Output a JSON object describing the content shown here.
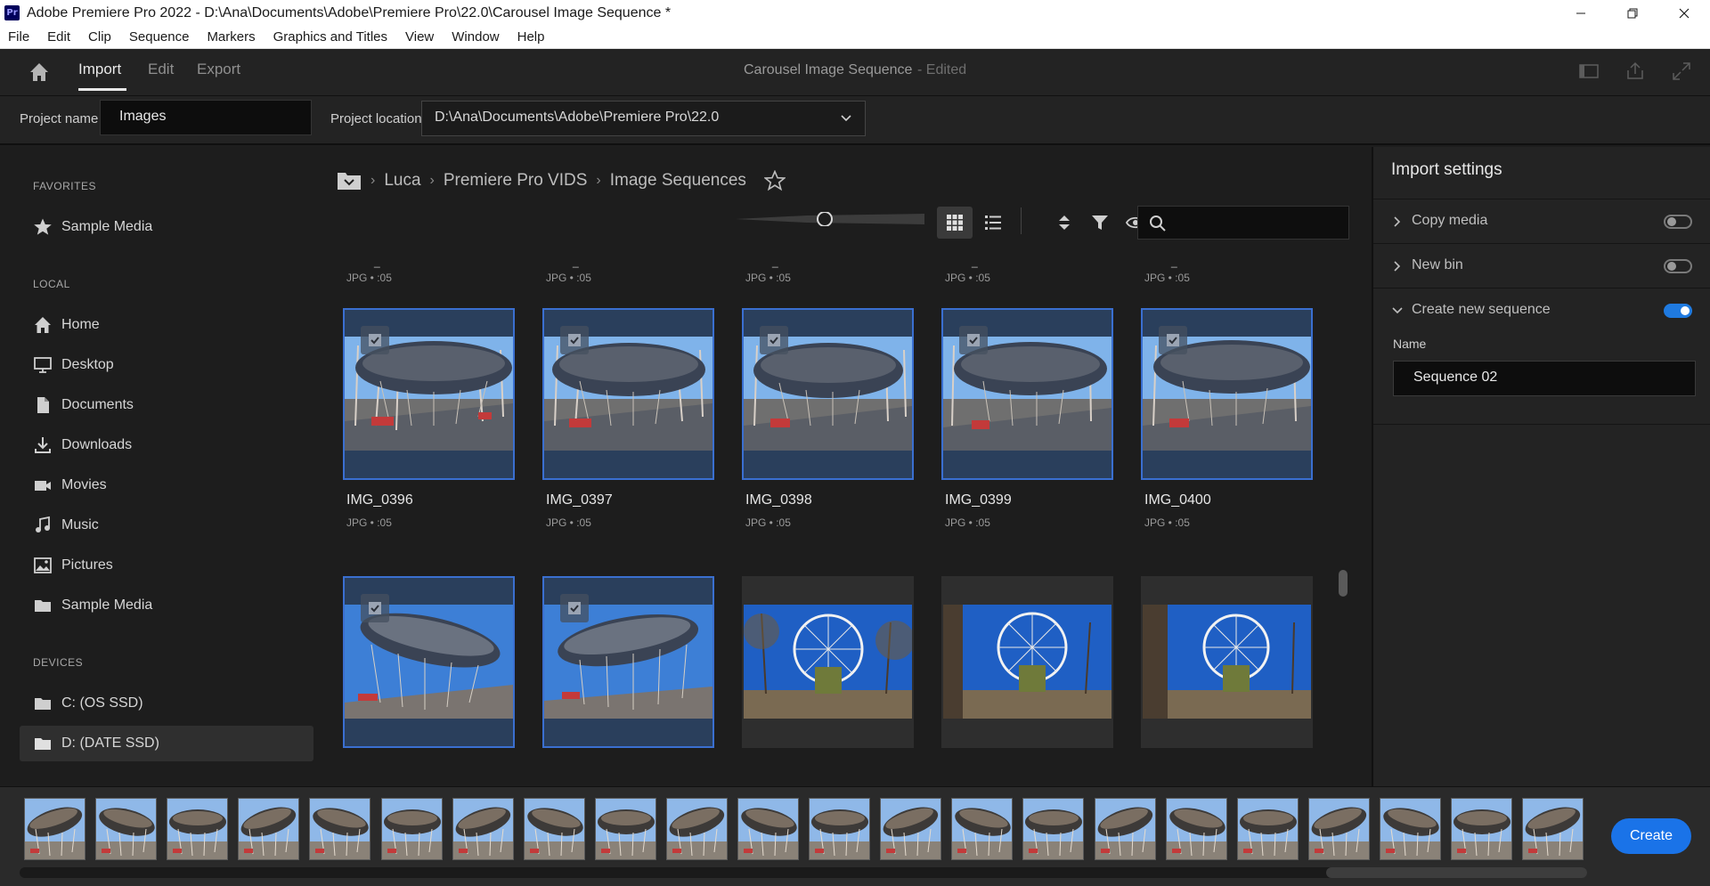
{
  "window": {
    "title": "Adobe Premiere Pro 2022 - D:\\Ana\\Documents\\Adobe\\Premiere Pro\\22.0\\Carousel Image Sequence *",
    "logo_text": "Pr"
  },
  "menu": [
    "File",
    "Edit",
    "Clip",
    "Sequence",
    "Markers",
    "Graphics and Titles",
    "View",
    "Window",
    "Help"
  ],
  "header": {
    "tabs": [
      "Import",
      "Edit",
      "Export"
    ],
    "active_tab": "Import",
    "project_title": "Carousel Image Sequence",
    "edited_label": "- Edited"
  },
  "project": {
    "name_label": "Project name",
    "name_value": "Images",
    "location_label": "Project location",
    "location_value": "D:\\Ana\\Documents\\Adobe\\Premiere Pro\\22.0"
  },
  "sidebar": {
    "favorites_title": "FAVORITES",
    "favorites": [
      {
        "label": "Sample Media",
        "icon": "star-icon"
      }
    ],
    "local_title": "LOCAL",
    "local": [
      {
        "label": "Home",
        "icon": "home-icon"
      },
      {
        "label": "Desktop",
        "icon": "desktop-icon"
      },
      {
        "label": "Documents",
        "icon": "document-icon"
      },
      {
        "label": "Downloads",
        "icon": "download-icon"
      },
      {
        "label": "Movies",
        "icon": "movie-icon"
      },
      {
        "label": "Music",
        "icon": "music-icon"
      },
      {
        "label": "Pictures",
        "icon": "picture-icon"
      },
      {
        "label": "Sample Media",
        "icon": "folder-icon"
      }
    ],
    "devices_title": "DEVICES",
    "devices": [
      {
        "label": "C: (OS SSD)",
        "icon": "folder-icon"
      },
      {
        "label": "D: (DATE SSD)",
        "icon": "folder-icon",
        "selected": true
      }
    ]
  },
  "breadcrumb": [
    "Luca",
    "Premiere Pro VIDS",
    "Image Sequences"
  ],
  "grid": {
    "top_row_meta": [
      "JPG • :05",
      "JPG • :05",
      "JPG • :05",
      "JPG • :05",
      "JPG • :05"
    ],
    "top_row_dash": "_",
    "row1": [
      {
        "name": "IMG_0396",
        "meta": "JPG • :05",
        "selected": true
      },
      {
        "name": "IMG_0397",
        "meta": "JPG • :05",
        "selected": true
      },
      {
        "name": "IMG_0398",
        "meta": "JPG • :05",
        "selected": true
      },
      {
        "name": "IMG_0399",
        "meta": "JPG • :05",
        "selected": true
      },
      {
        "name": "IMG_0400",
        "meta": "JPG • :05",
        "selected": true
      }
    ],
    "row2": [
      {
        "selected": true,
        "kind": "carousel"
      },
      {
        "selected": true,
        "kind": "carousel"
      },
      {
        "selected": false,
        "kind": "ferris"
      },
      {
        "selected": false,
        "kind": "ferris"
      },
      {
        "selected": false,
        "kind": "ferris"
      }
    ]
  },
  "import_settings": {
    "title": "Import settings",
    "copy_media": {
      "label": "Copy media",
      "on": false
    },
    "new_bin": {
      "label": "New bin",
      "on": false
    },
    "create_sequence": {
      "label": "Create new sequence",
      "on": true
    },
    "name_label": "Name",
    "name_value": "Sequence 02"
  },
  "filmstrip": {
    "count": 22
  },
  "create_label": "Create",
  "colors": {
    "accent": "#1a73e8",
    "selection_border": "#3a6fd0"
  }
}
